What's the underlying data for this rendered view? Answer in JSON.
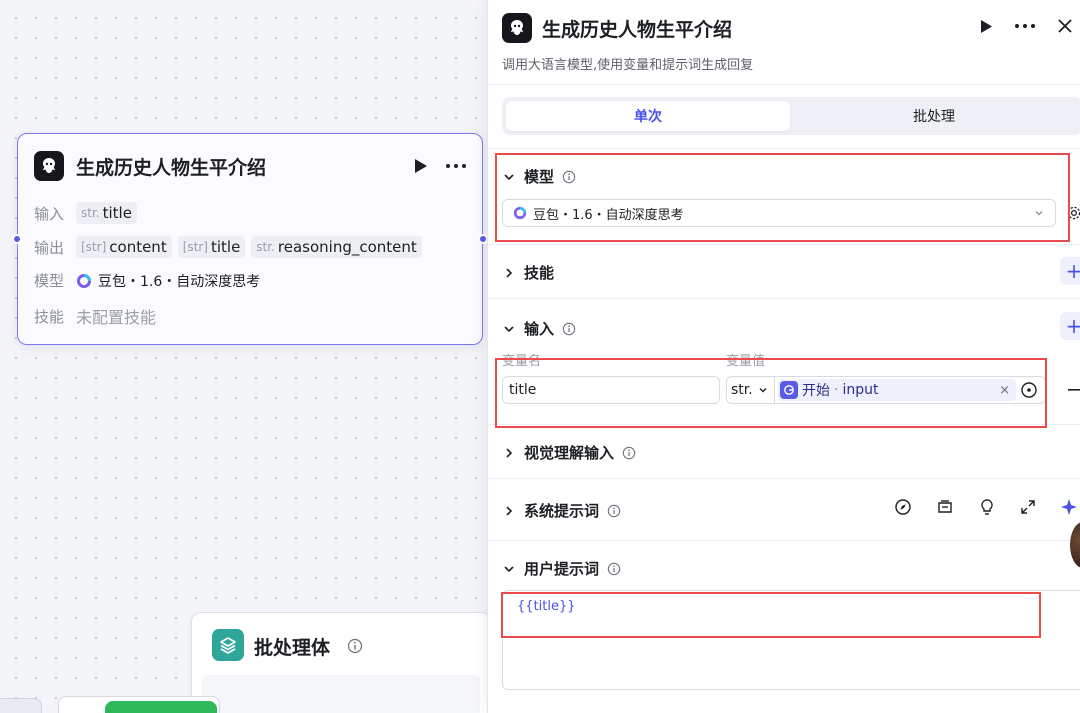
{
  "node": {
    "title": "生成历史人物生平介绍",
    "input_label": "输入",
    "input_var": {
      "type": "str.",
      "name": "title"
    },
    "output_label": "输出",
    "outputs": [
      {
        "type": "[str]",
        "name": "content"
      },
      {
        "type": "[str]",
        "name": "title"
      },
      {
        "type": "str.",
        "name": "reasoning_content"
      }
    ],
    "model_label": "模型",
    "model_value": "豆包・1.6・自动深度思考",
    "skill_label": "技能",
    "skill_value": "未配置技能"
  },
  "batch": {
    "title": "批处理体"
  },
  "panel": {
    "title": "生成历史人物生平介绍",
    "description": "调用大语言模型,使用变量和提示词生成回复",
    "tabs": [
      "单次",
      "批处理"
    ],
    "sections": {
      "model": "模型",
      "skills": "技能",
      "input": "输入",
      "vision": "视觉理解输入",
      "system_prompt": "系统提示词",
      "user_prompt": "用户提示词"
    },
    "model_select": "豆包・1.6・自动深度思考",
    "input_columns": {
      "name": "变量名",
      "value": "变量值"
    },
    "input_row": {
      "name": "title",
      "type": "str.",
      "ref_source": "开始",
      "ref_separator": "·",
      "ref_field": "input"
    },
    "user_prompt_text": "{{title}}"
  },
  "colors": {
    "accent": "#4a52e8",
    "node_border": "#7c78f0",
    "highlight_red": "#e84c4c",
    "batch_icon": "#2ea79a"
  }
}
